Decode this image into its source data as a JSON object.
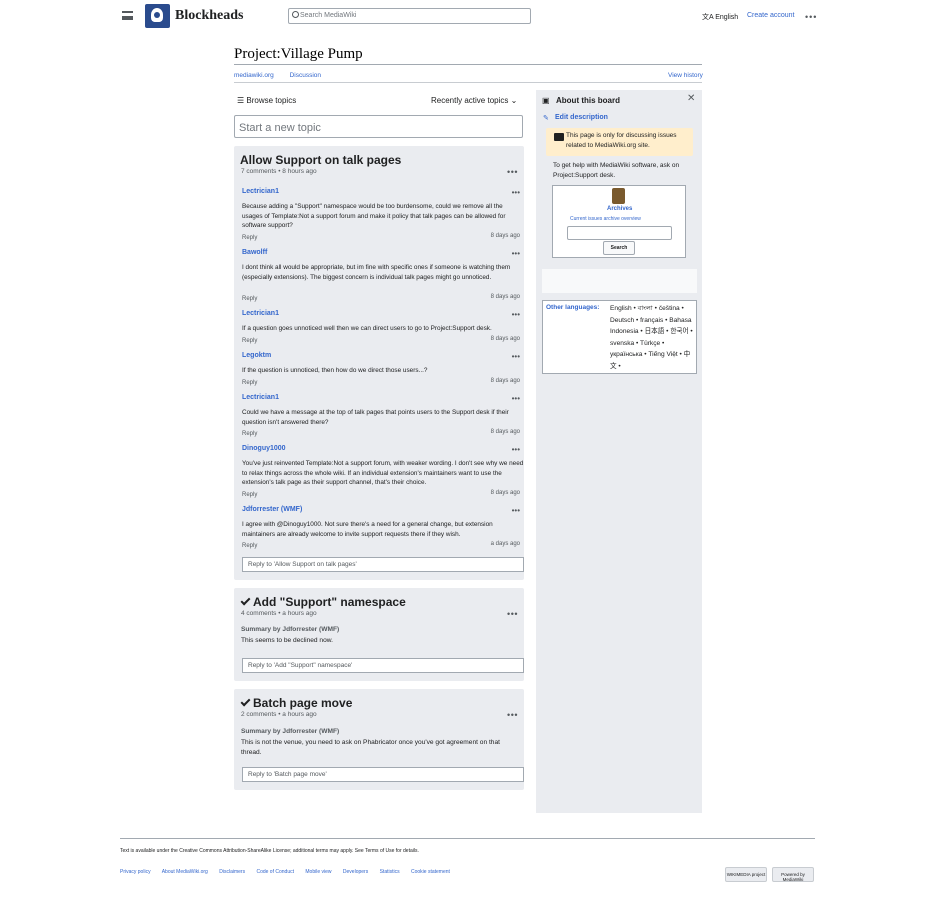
{
  "header": {
    "site_name": "Blockheads",
    "search_placeholder": "Search MediaWiki",
    "language": "English",
    "create_account": "Create account"
  },
  "page": {
    "title": "Project:Village Pump",
    "tab_left1": "mediawiki.org",
    "tab_left2": "Discussion",
    "tab_right": "View history",
    "browse_topics": "Browse topics",
    "sort": "Recently active topics",
    "new_topic_placeholder": "Start a new topic"
  },
  "topic1": {
    "title": "Allow Support on talk pages",
    "meta": "7 comments • 8 hours ago",
    "posts": [
      {
        "author": "Lectrician1",
        "text": "Because adding a \"Support\" namespace would be too burdensome, could we remove all the usages of Template:Not a support forum and make it policy that talk pages can be allowed for software support?",
        "reply": "Reply",
        "time": "8 days ago"
      },
      {
        "author": "Bawolff",
        "text": "I dont think all would be appropriate, but im fine with specific ones if someone is watching them (especially extensions). The biggest concern is individual talk pages might go unnoticed.",
        "reply": "Reply",
        "time": "8 days ago"
      },
      {
        "author": "Lectrician1",
        "text": "If a question goes unnoticed well then we can direct users to go to Project:Support desk.",
        "reply": "Reply",
        "time": "8 days ago"
      },
      {
        "author": "Legoktm",
        "text": "If the question is unnoticed, then how do we direct those users...?",
        "reply": "Reply",
        "time": "8 days ago"
      },
      {
        "author": "Lectrician1",
        "text": "Could we have a message at the top of talk pages that points users to the Support desk if their question isn't answered there?",
        "reply": "Reply",
        "time": "8 days ago"
      },
      {
        "author": "Dinoguy1000",
        "text": "You've just reinvented Template:Not a support forum, with weaker wording. I don't see why we need to relax things across the whole wiki. If an individual extension's maintainers want to use the extension's talk page as their support channel, that's their choice.",
        "reply": "Reply",
        "time": "8 days ago"
      },
      {
        "author": "Jdforrester (WMF)",
        "text": "I agree with @Dinoguy1000. Not sure there's a need for a general change, but extension maintainers are already welcome to invite support requests there if they wish.",
        "reply": "Reply",
        "time": "a days ago"
      }
    ],
    "reply_placeholder": "Reply to 'Allow Support on talk pages'"
  },
  "topic2": {
    "title": "Add \"Support\" namespace",
    "meta": "4 comments • a hours ago",
    "summary_by": "Summary by Jdforrester (WMF)",
    "summary": "This seems to be declined now.",
    "reply_placeholder": "Reply to 'Add \"Support\" namespace'"
  },
  "topic3": {
    "title": "Batch page move",
    "meta": "2 comments • a hours ago",
    "summary_by": "Summary by Jdforrester (WMF)",
    "summary": "This is not the venue, you need to ask on Phabricator once you've got agreement on that thread.",
    "reply_placeholder": "Reply to 'Batch page move'"
  },
  "sidebar": {
    "title": "About this board",
    "edit": "Edit description",
    "notice": "This page is only for discussing issues related to MediaWiki.org site.",
    "help": "To get help with MediaWiki software, ask on Project:Support desk.",
    "archives": "Archives",
    "archive_links": "Current issues archive overview",
    "search_btn": "Search",
    "other_languages": "Other languages:",
    "languages": "English • বাংলা • čeština • Deutsch • français • Bahasa Indonesia • 日本語 • 한국어 • svenska • Türkçe • українська • Tiếng Việt • 中文 •"
  },
  "footer": {
    "line1": "Text is available under the Creative Commons Attribution-ShareAlike License; additional terms may apply. See Terms of Use for details.",
    "links": [
      "Privacy policy",
      "About MediaWiki.org",
      "Disclaimers",
      "Code of Conduct",
      "Mobile view",
      "Developers",
      "Statistics",
      "Cookie statement"
    ],
    "wikimedia": "WIKIMEDIA project",
    "powered": "Powered by MediaWiki"
  }
}
